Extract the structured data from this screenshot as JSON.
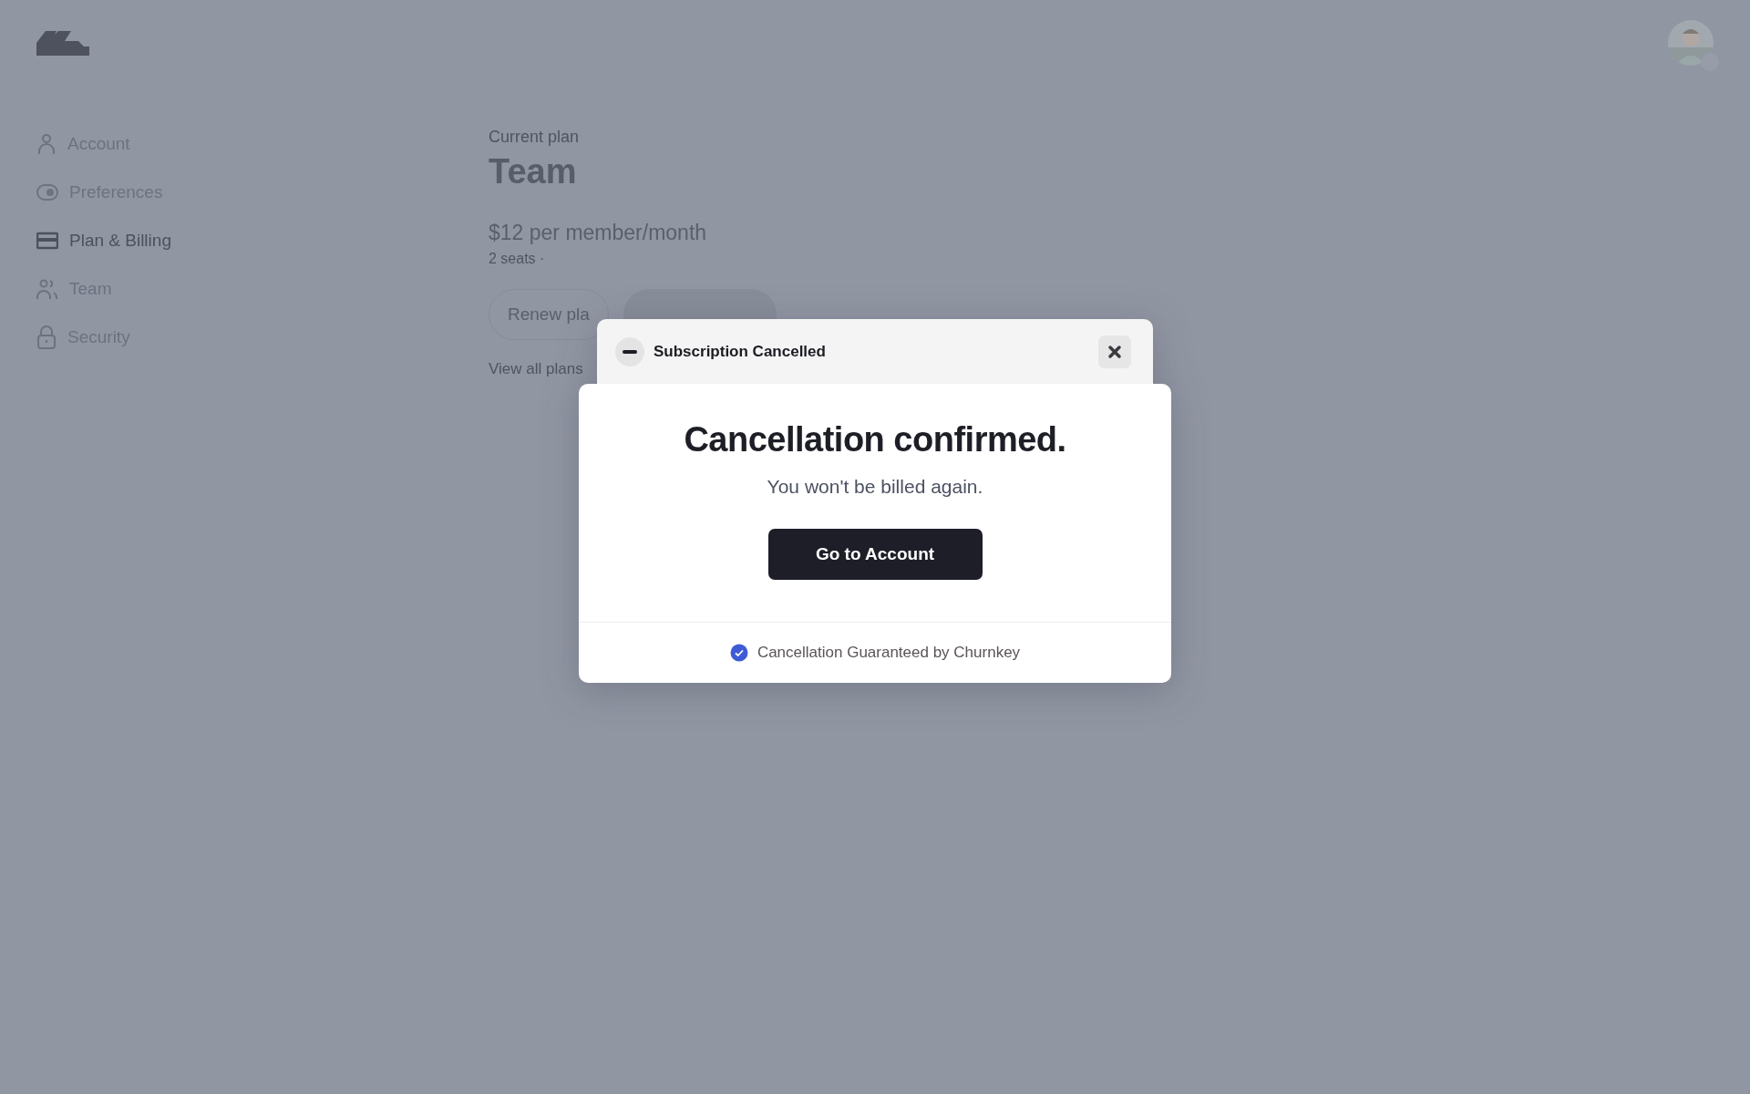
{
  "sidebar": {
    "items": [
      {
        "label": "Account",
        "selected": false
      },
      {
        "label": "Preferences",
        "selected": false
      },
      {
        "label": "Plan & Billing",
        "selected": true
      },
      {
        "label": "Team",
        "selected": false
      },
      {
        "label": "Security",
        "selected": false
      }
    ]
  },
  "plan": {
    "eyebrow": "Current plan",
    "name": "Team",
    "price": "$12 per member/month",
    "seats": "2 seats ·",
    "buttons": [
      {
        "label": "Renew pla",
        "kind": "outline"
      },
      {
        "kind": "filled"
      }
    ],
    "link": "View all plans"
  },
  "dialog": {
    "title": "Subscription Cancelled",
    "heading": "Cancellation confirmed.",
    "message": "You won't be billed again.",
    "button": "Go to Account",
    "footer": "Cancellation Guaranteed by Churnkey"
  }
}
